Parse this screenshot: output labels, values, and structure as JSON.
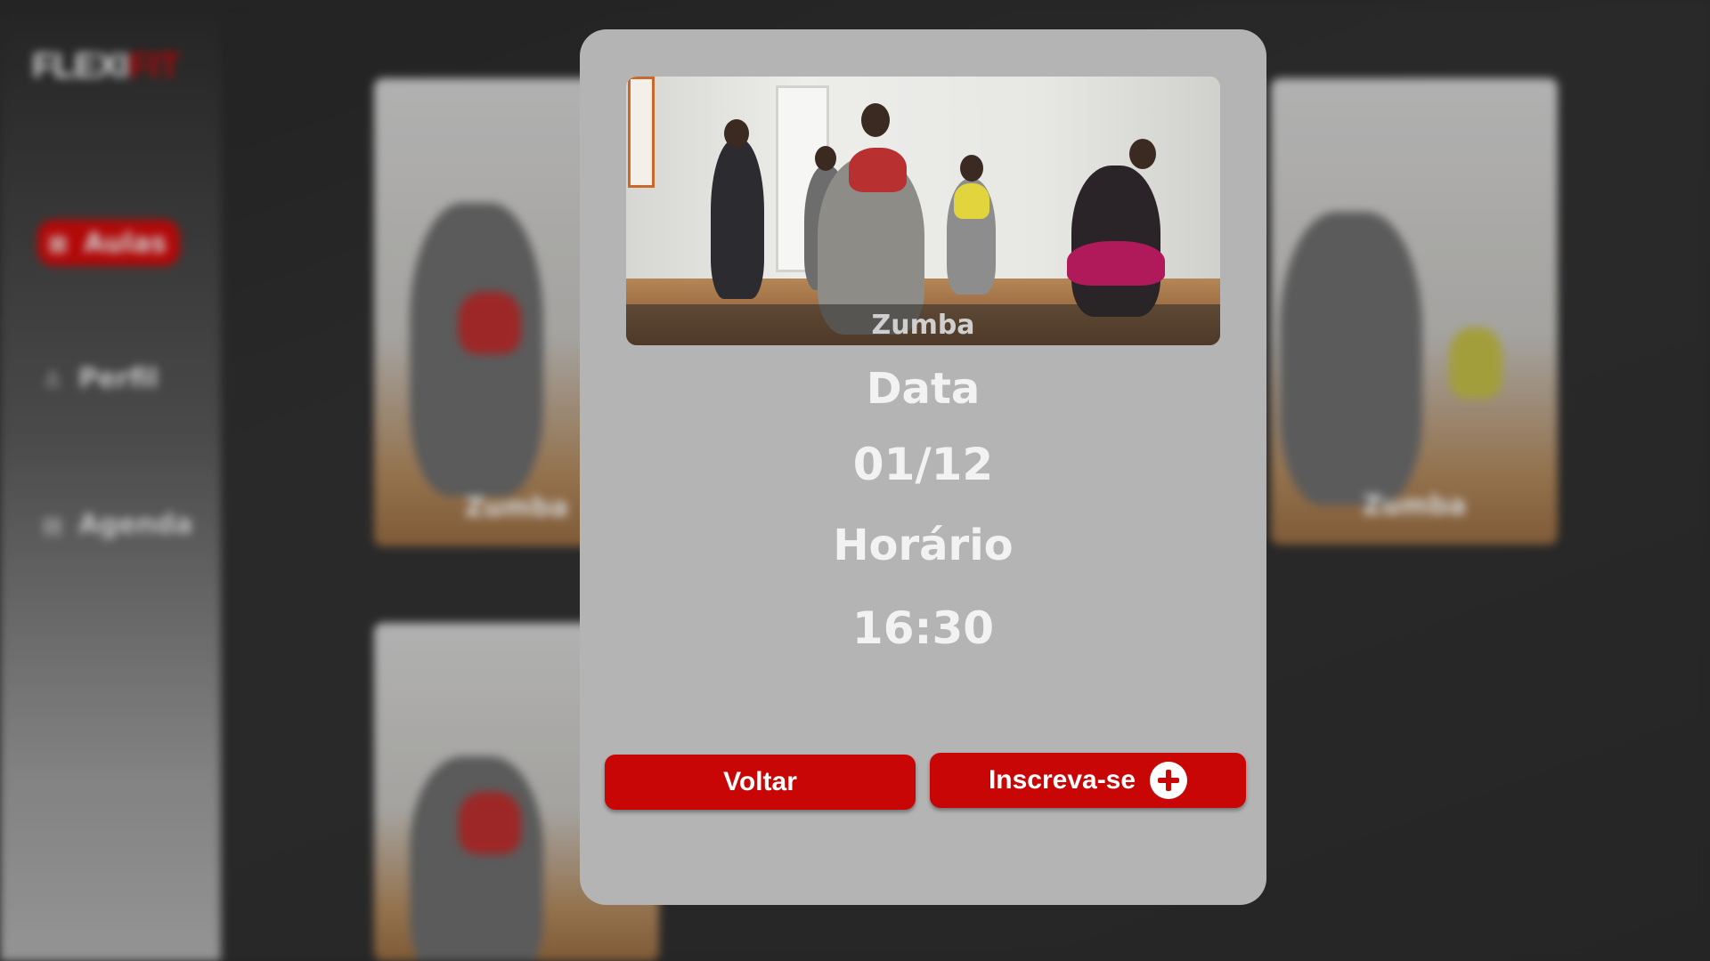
{
  "app": {
    "logo_part1": "FLEXI",
    "logo_part2": "FIT"
  },
  "sidebar": {
    "items": [
      {
        "label": "Aulas",
        "icon": "grid-icon",
        "active": true
      },
      {
        "label": "Perfil",
        "icon": "user-icon",
        "active": false
      },
      {
        "label": "Agenda",
        "icon": "calendar-icon",
        "active": false
      }
    ]
  },
  "background_cards": [
    {
      "caption": "Zumba"
    },
    {
      "caption": "Zumba"
    }
  ],
  "modal": {
    "image_caption": "Zumba",
    "date_label": "Data",
    "date_value": "01/12",
    "time_label": "Horário",
    "time_value": "16:30",
    "back_button": "Voltar",
    "enroll_button": "Inscreva-se",
    "enroll_icon": "plus-circle-icon"
  },
  "colors": {
    "accent": "#c80606",
    "modal_bg": "#b4b4b4",
    "page_bg": "#2f2f2f"
  }
}
